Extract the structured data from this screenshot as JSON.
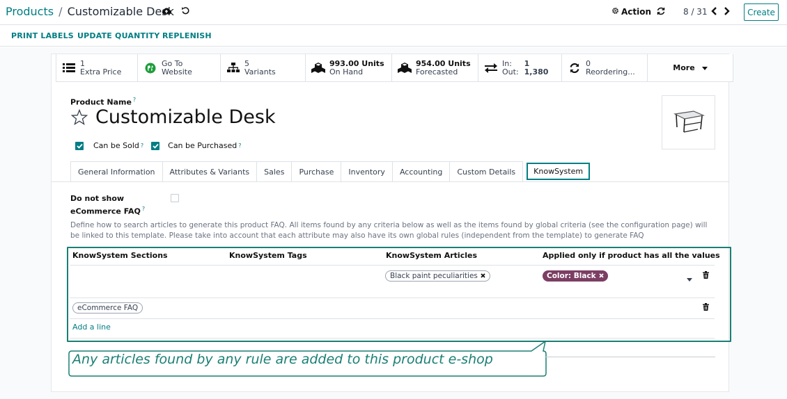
{
  "breadcrumb": {
    "parent": "Products",
    "current": "Customizable Desk"
  },
  "header": {
    "action_label": "Action",
    "pager": "8 / 31",
    "create_label": "Create"
  },
  "action_buttons": [
    "PRINT LABELS",
    "UPDATE QUANTITY",
    "REPLENISH"
  ],
  "smart_buttons": {
    "extra_price": {
      "value": "1",
      "label": "Extra Price",
      "icon": "list-icon"
    },
    "website": {
      "value": "Go To",
      "label": "Website",
      "icon": "globe-icon"
    },
    "variants": {
      "value": "5",
      "label": "Variants",
      "icon": "sitemap-icon"
    },
    "on_hand": {
      "value": "993.00 Units",
      "label": "On Hand",
      "icon": "cubes-icon"
    },
    "forecasted": {
      "value": "954.00 Units",
      "label": "Forecasted",
      "icon": "cubes-icon"
    },
    "in_out": {
      "in_label": "In:",
      "in_value": "1",
      "out_label": "Out:",
      "out_value": "1,380",
      "icon": "exchange-icon"
    },
    "reordering": {
      "value": "0",
      "label": "Reordering...",
      "icon": "refresh-icon"
    },
    "more_label": "More"
  },
  "product": {
    "name_label": "Product Name",
    "tooltip_mark": "?",
    "name": "Customizable Desk",
    "can_be_sold_label": "Can be Sold",
    "can_be_sold": true,
    "can_be_purchased_label": "Can be Purchased",
    "can_be_purchased": true
  },
  "tabs": [
    "General Information",
    "Attributes & Variants",
    "Sales",
    "Purchase",
    "Inventory",
    "Accounting",
    "Custom Details",
    "KnowSystem"
  ],
  "active_tab": "KnowSystem",
  "knowsystem": {
    "dns_label_line1": "Do not show",
    "dns_label_line2": "eCommerce FAQ",
    "dns_checked": false,
    "description": "Define how to search articles to generate this product FAQ. All items found by any criteria below as well as the items found by global criteria (see the configuration page) will be linked to this template. Please take into account that each attribute may also have its own global rules (independent from the template) to generate FAQ",
    "columns": [
      "KnowSystem Sections",
      "KnowSystem Tags",
      "KnowSystem Articles",
      "Applied only if product has all the values"
    ],
    "rows": [
      {
        "sections": "",
        "tags": "",
        "article_tag": "Black paint peculiarities",
        "value_tag": "Color: Black"
      },
      {
        "sections": "eCommerce FAQ",
        "tags": "",
        "article_tag": "",
        "value_tag": ""
      }
    ],
    "add_line_label": "Add a line"
  },
  "callout": "Any articles found by any rule are added to this product e-shop",
  "colors": {
    "accent": "#017e84",
    "callout": "#1a7f74",
    "value_tag": "#7c3e63"
  }
}
